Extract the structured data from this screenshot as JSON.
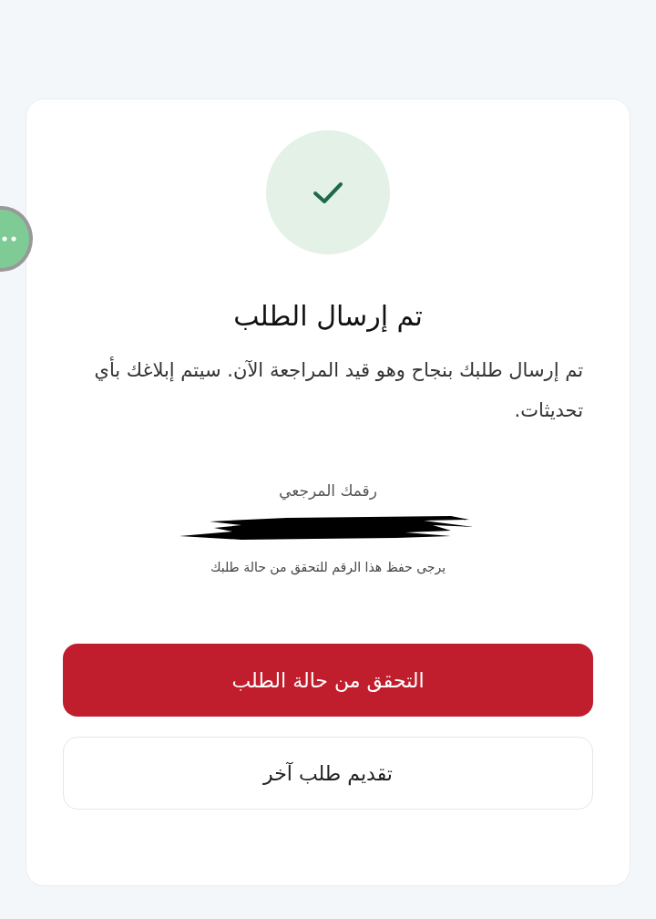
{
  "status": {
    "kind": "success"
  },
  "title": "تم إرسال الطلب",
  "message": "تم إرسال طلبك بنجاح وهو قيد المراجعة الآن. سيتم إبلاغك بأي تحديثات.",
  "reference": {
    "label": "رقمك المرجعي",
    "note": "يرجى حفظ هذا الرقم للتحقق من حالة طلبك"
  },
  "buttons": [
    {
      "label": "التحقق من حالة الطلب",
      "kind": "primary"
    },
    {
      "label": "تقديم طلب آخر",
      "kind": "secondary"
    }
  ]
}
